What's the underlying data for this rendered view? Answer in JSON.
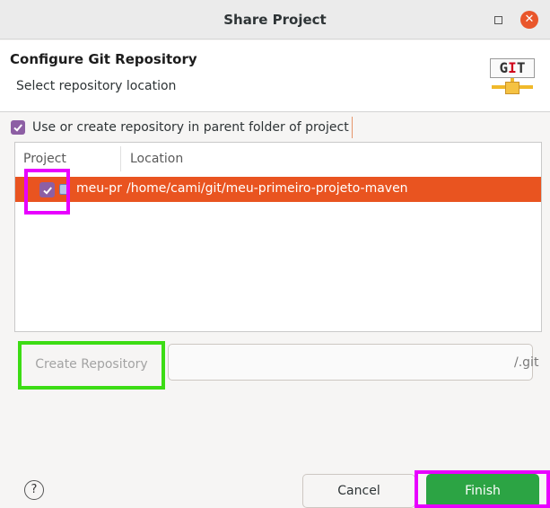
{
  "window": {
    "title": "Share Project",
    "maximize_icon": "maximize-icon",
    "close_icon": "close-icon",
    "close_glyph": "✕"
  },
  "header": {
    "title": "Configure Git Repository",
    "subtitle": "Select repository location",
    "logo_icon": "git-logo-icon",
    "logo_text_a": "G",
    "logo_text_b": "I",
    "logo_text_c": "T"
  },
  "use_parent": {
    "checked": true,
    "label": "Use or create repository in parent folder of project"
  },
  "table": {
    "columns": [
      "Project",
      "Location"
    ],
    "rows": [
      {
        "checked": true,
        "project": "meu-primeiro-projeto-maven",
        "location": "/home/cami/git/meu-primeiro-projeto-maven",
        "selected": true
      }
    ]
  },
  "create_repository": {
    "button_label": "Create Repository",
    "path_value": "",
    "suffix": "/.git",
    "enabled": false
  },
  "footer": {
    "help_icon": "help-icon",
    "help_glyph": "?",
    "cancel_label": "Cancel",
    "finish_label": "Finish"
  },
  "colors": {
    "selection": "#e95420",
    "checkbox": "#8d5fa4",
    "finish": "#2ca444",
    "highlight_magenta": "#e800ff",
    "highlight_green": "#3cdc14"
  }
}
